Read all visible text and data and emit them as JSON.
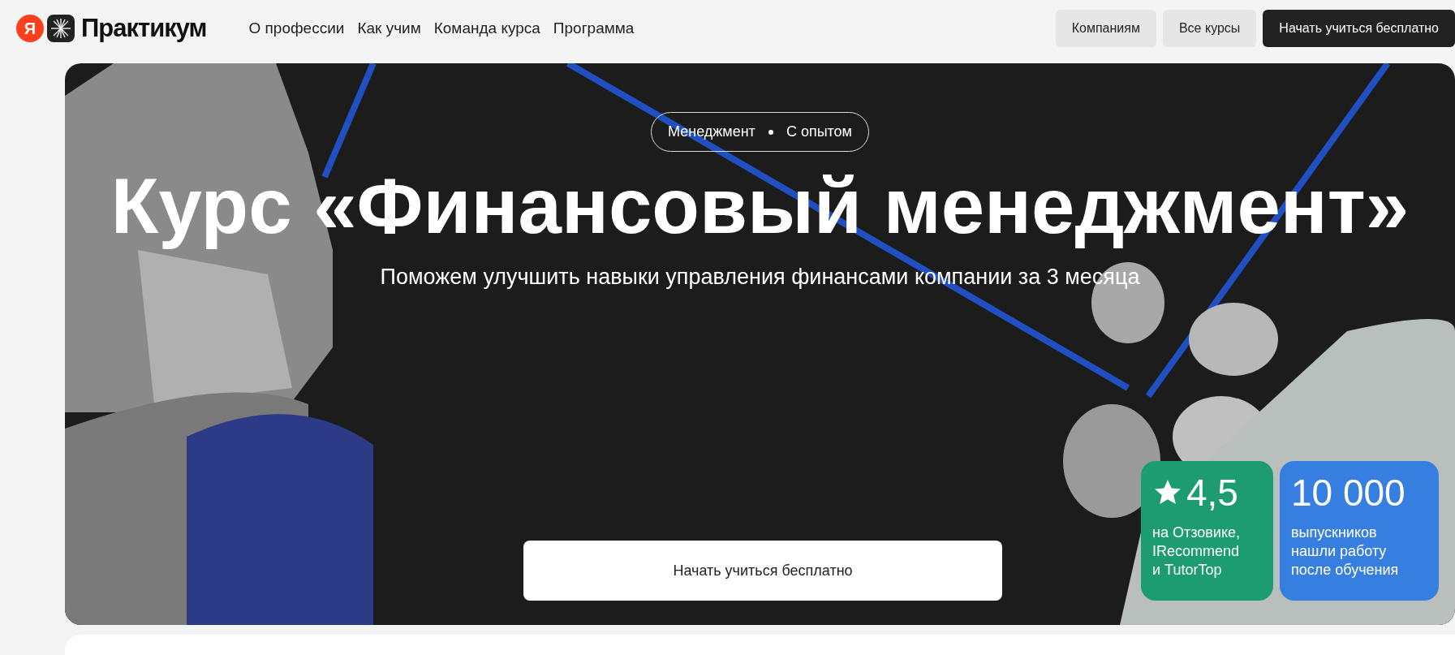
{
  "header": {
    "logo": {
      "mark": "Я",
      "name": "Практикум"
    },
    "nav": [
      {
        "label": "О профессии"
      },
      {
        "label": "Как учим"
      },
      {
        "label": "Команда курса"
      },
      {
        "label": "Программа"
      }
    ],
    "buttons": [
      {
        "label": "Компаниям",
        "kind": "light"
      },
      {
        "label": "Все курсы",
        "kind": "light"
      },
      {
        "label": "Начать учиться бесплатно",
        "kind": "dark"
      }
    ]
  },
  "hero": {
    "tags": [
      "Менеджмент",
      "С опытом"
    ],
    "title": "Курс «Финансовый менеджмент»",
    "subtitle": "Поможем улучшить навыки управления финансами компании за 3 месяца",
    "cta": "Начать учиться бесплатно",
    "stats": [
      {
        "value": "4,5",
        "caption": "на Отзовике, IRecommend и TutorTop",
        "kind": "rating",
        "color": "#1d9c71"
      },
      {
        "value": "10 000",
        "caption": "выпускников нашли работу после обучения",
        "kind": "count",
        "color": "#367ee0"
      }
    ]
  }
}
